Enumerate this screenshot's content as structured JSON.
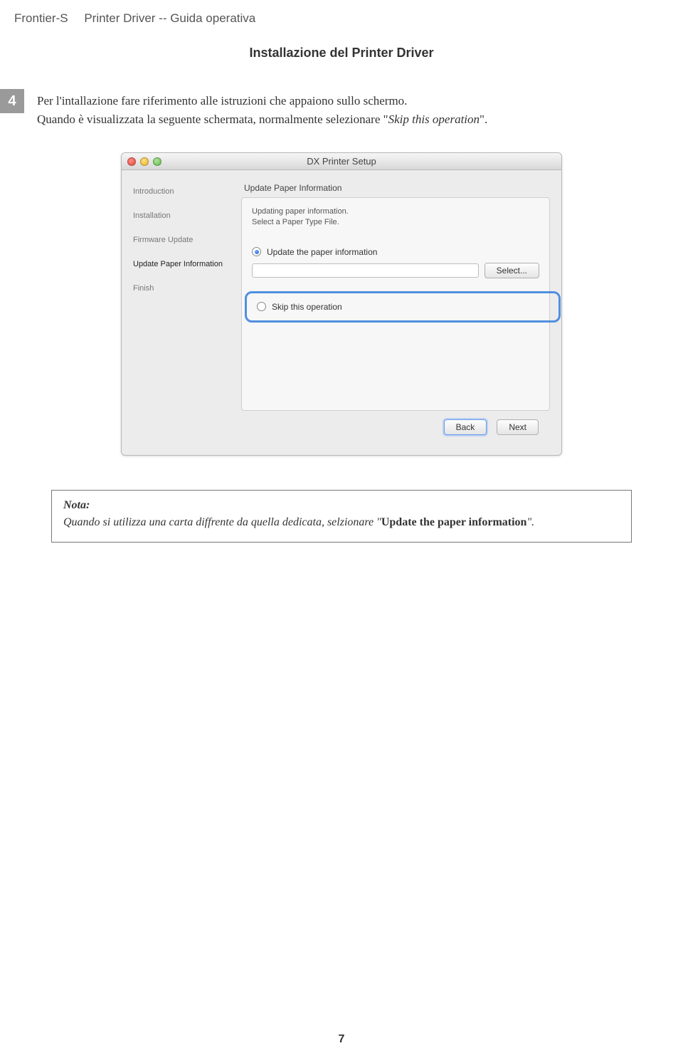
{
  "header": {
    "product": "Frontier-S",
    "subtitle": "Printer Driver -- Guida operativa"
  },
  "section_title": "Installazione del Printer Driver",
  "step": {
    "number": "4",
    "text_a": "Per l'intallazione fare riferimento alle istruzioni che appaiono sullo schermo.",
    "text_b_pre": "Quando è visualizzata la seguente schermata, normalmente selezionare \"",
    "text_b_ital": "Skip this operation",
    "text_b_post": "\"."
  },
  "window": {
    "title": "DX Printer Setup",
    "sidebar": [
      "Introduction",
      "Installation",
      "Firmware Update",
      "Update Paper Information",
      "Finish"
    ],
    "content_header": "Update Paper Information",
    "intro_line1": "Updating paper information.",
    "intro_line2": "Select a Paper Type File.",
    "radio_update": "Update the paper information",
    "radio_skip": "Skip this operation",
    "select_btn": "Select...",
    "back_btn": "Back",
    "next_btn": "Next"
  },
  "nota": {
    "title": "Nota:",
    "body_pre": "Quando si utilizza una carta diffrente da quella dedicata, selzionare \"",
    "body_bold": "Update the paper information",
    "body_post": "\"."
  },
  "page_number": "7"
}
